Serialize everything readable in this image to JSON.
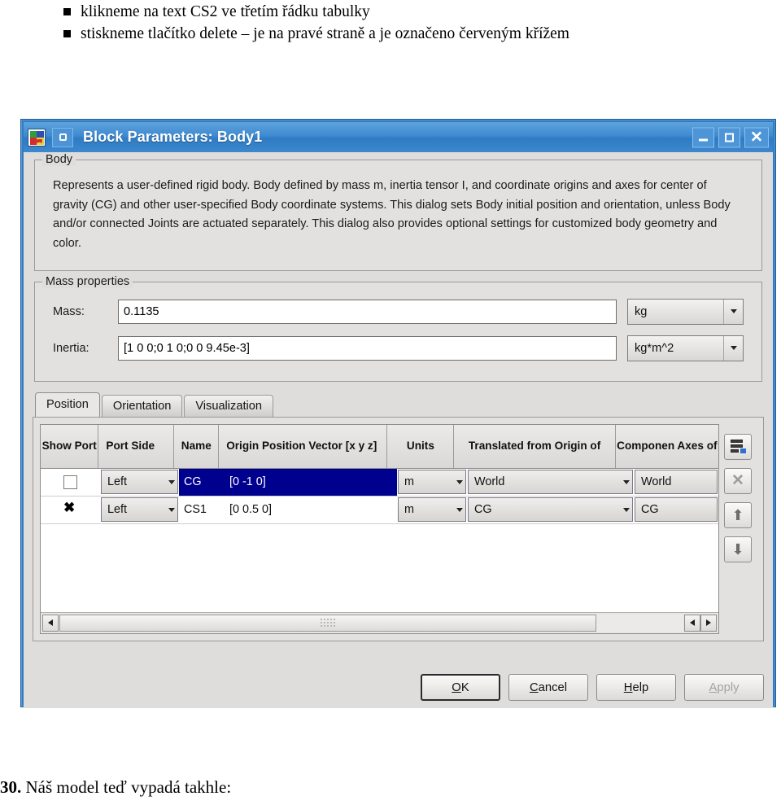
{
  "document": {
    "bullets": [
      "klikneme na text CS2 ve třetím řádku tabulky",
      "stiskneme tlačítko delete – je na pravé straně a je označeno červeným křížem"
    ],
    "footer_number": "30.",
    "footer_text": " Náš model teď vypadá takhle:"
  },
  "dialog": {
    "title": "Block Parameters: Body1",
    "icons": {
      "app": "simulink-block-icon",
      "menu": "window-menu-icon",
      "minimize": "minimize-icon",
      "maximize": "maximize-icon",
      "close": "close-icon"
    },
    "body_group": {
      "legend": "Body",
      "description": "Represents a user-defined rigid body. Body defined by mass m, inertia tensor I, and coordinate origins and axes for center of gravity (CG) and other user-specified Body coordinate systems. This dialog sets Body initial position and orientation, unless Body and/or connected Joints are actuated separately. This dialog also provides optional settings for customized body geometry and color."
    },
    "mass_group": {
      "legend": "Mass properties",
      "mass": {
        "label": "Mass:",
        "value": "0.1135",
        "unit": "kg"
      },
      "inertia": {
        "label": "Inertia:",
        "value": "[1 0 0;0 1 0;0 0 9.45e-3]",
        "unit": "kg*m^2"
      }
    },
    "tabs": [
      {
        "label": "Position",
        "active": true
      },
      {
        "label": "Orientation",
        "active": false
      },
      {
        "label": "Visualization",
        "active": false
      }
    ],
    "table": {
      "columns": [
        "Show Port",
        "Port Side",
        "Name",
        "Origin Position Vector [x y z]",
        "Units",
        "Translated from Origin of",
        "Componen Axes of"
      ],
      "rows": [
        {
          "show_port": false,
          "port_side": "Left",
          "name": "CG",
          "origin_position": "[0 -1 0]",
          "units": "m",
          "translated_from": "World",
          "components_axes": "World",
          "selected": true
        },
        {
          "show_port": true,
          "port_side": "Left",
          "name": "CS1",
          "origin_position": "[0 0.5 0]",
          "units": "m",
          "translated_from": "CG",
          "components_axes": "CG",
          "selected": false
        }
      ]
    },
    "side_tools": [
      {
        "name": "add-row-icon",
        "enabled": true
      },
      {
        "name": "delete-row-icon",
        "enabled": false
      },
      {
        "name": "move-up-icon",
        "enabled": true
      },
      {
        "name": "move-down-icon",
        "enabled": true
      }
    ],
    "buttons": [
      {
        "label": "OK",
        "mnemonic": "O",
        "rest": "K",
        "state": "focused"
      },
      {
        "label": "Cancel",
        "mnemonic": "C",
        "rest": "ancel",
        "state": "normal"
      },
      {
        "label": "Help",
        "mnemonic": "H",
        "rest": "elp",
        "state": "normal"
      },
      {
        "label": "Apply",
        "mnemonic": "A",
        "rest": "pply",
        "state": "disabled"
      }
    ]
  },
  "colors": {
    "title_blue": "#2f7dc4",
    "selection_blue": "#00008f",
    "dialog_gray": "#dedddb"
  }
}
